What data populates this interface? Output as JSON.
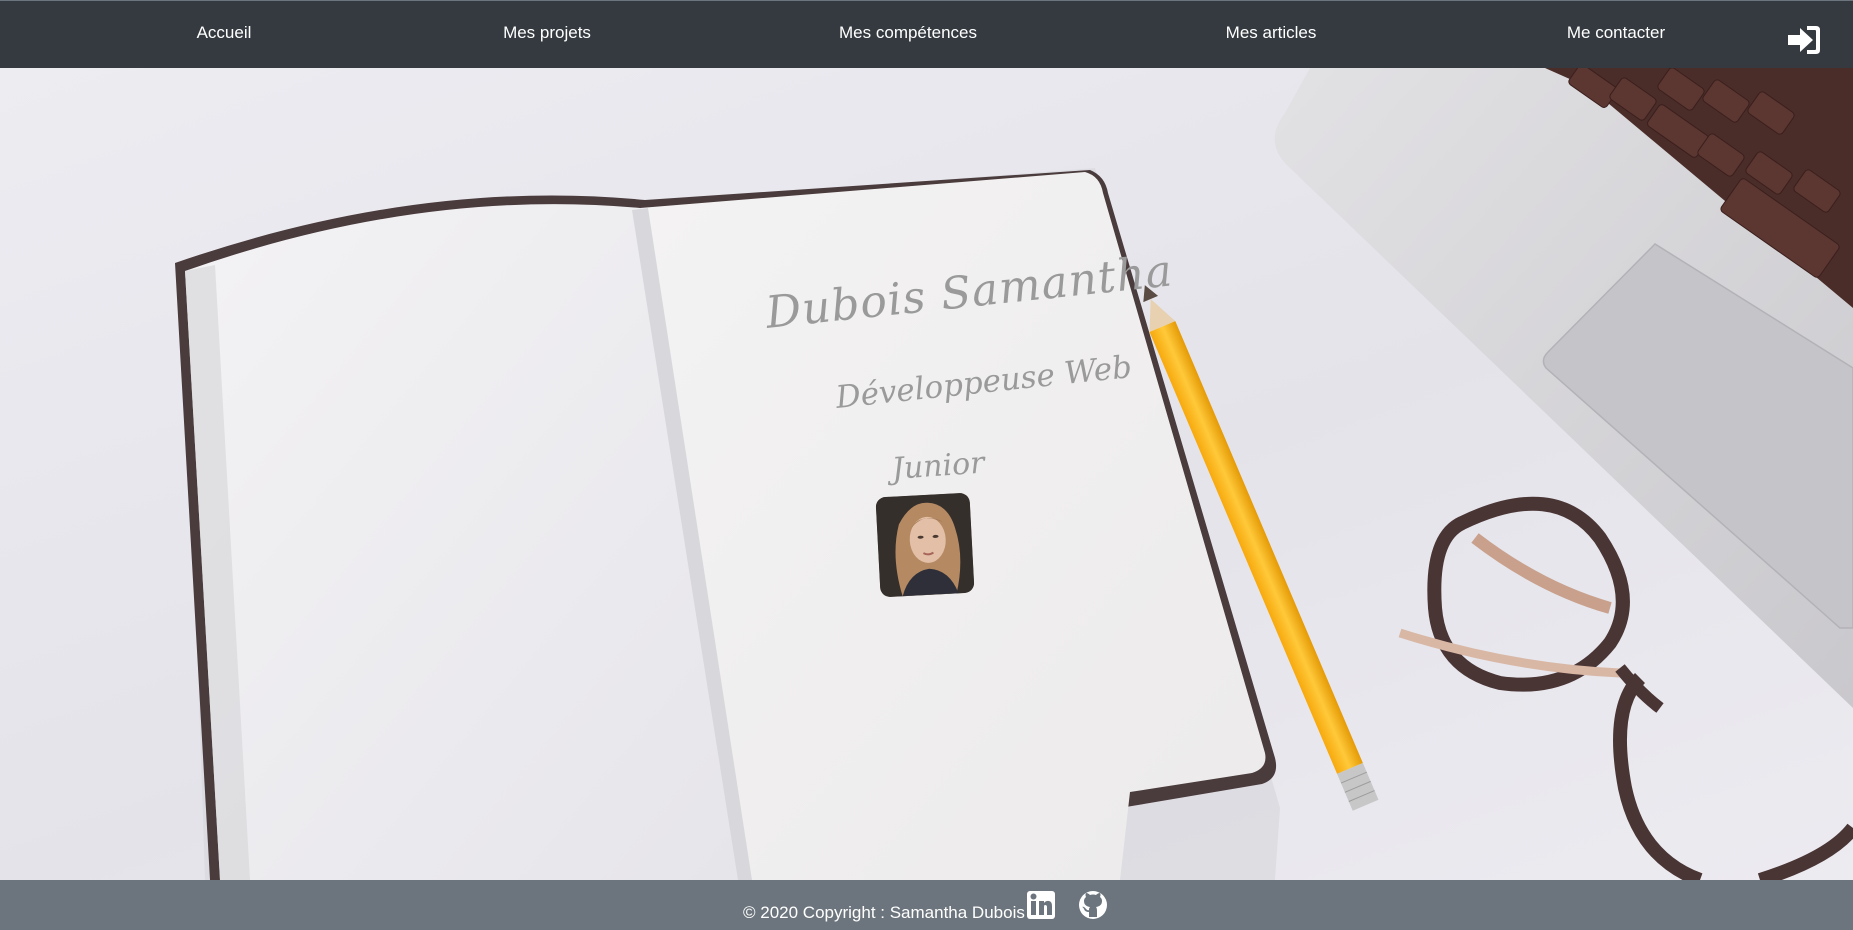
{
  "nav": {
    "items": [
      {
        "label": "Accueil"
      },
      {
        "label": "Mes projets"
      },
      {
        "label": "Mes compétences"
      },
      {
        "label": "Mes articles"
      },
      {
        "label": "Me contacter"
      }
    ],
    "login_icon": "sign-in-icon"
  },
  "hero": {
    "name": "Dubois Samantha",
    "role": "Développeuse Web",
    "level": "Junior",
    "photo": "profile-photo"
  },
  "footer": {
    "copyright": "© 2020 Copyright : Samantha Dubois",
    "social": [
      {
        "icon": "linkedin-icon"
      },
      {
        "icon": "github-icon"
      }
    ]
  },
  "colors": {
    "navbar_bg": "#343a40",
    "footer_bg": "#6c757d",
    "pencil": "#fbb216",
    "text_light": "#ffffff"
  }
}
